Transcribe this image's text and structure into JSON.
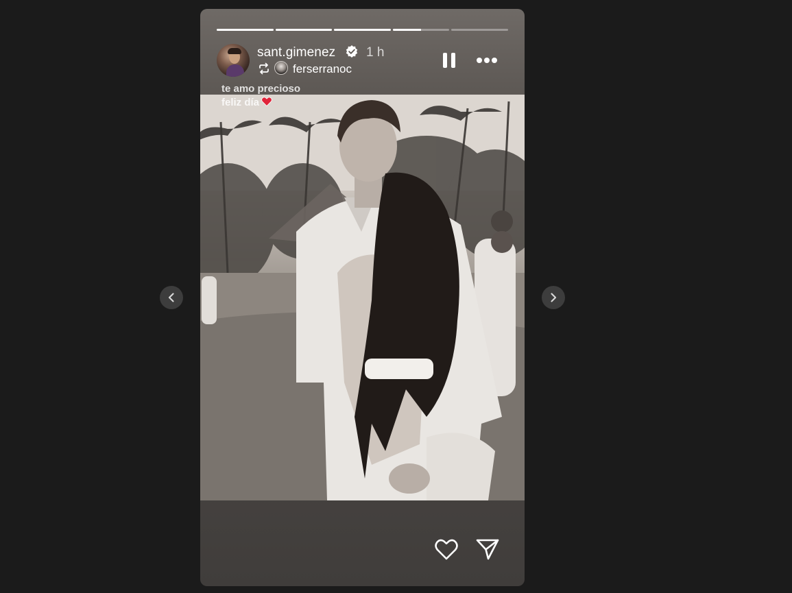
{
  "story": {
    "username": "sant.gimenez",
    "verified": true,
    "time": "1 h",
    "reposted_from": "ferserranoc",
    "caption_line1": "te amo precioso",
    "caption_line2": "feliz día",
    "caption_emoji": "heart-emoji",
    "progress": [
      1,
      1,
      1,
      0.5,
      0
    ],
    "photo_description_icon": "photo-icon"
  },
  "controls": {
    "pause_icon": "pause-icon",
    "more_icon": "more-options-icon",
    "like_icon": "heart-icon",
    "share_icon": "send-icon",
    "prev_icon": "chevron-left-icon",
    "next_icon": "chevron-right-icon"
  },
  "colors": {
    "background": "#1b1b1b",
    "progress_active": "#ffffff",
    "progress_inactive": "rgba(255,255,255,0.35)",
    "verified_badge": "#ffffff",
    "caption_heart": "#e0243a",
    "nav_button": "#3d3d3d"
  }
}
